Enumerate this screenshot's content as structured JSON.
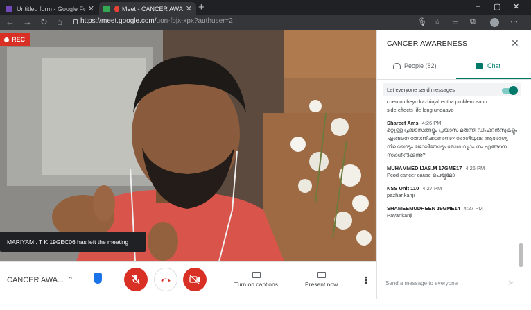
{
  "browser": {
    "tabs": [
      {
        "title": "Untitled form - Google Forms",
        "fav_color": "#7248b9"
      },
      {
        "title": "Meet - CANCER AWARENESS",
        "fav_color": "#34a853"
      }
    ],
    "url_host": "https://meet.google.com/",
    "url_path": "uon-fpjx-xpx?authuser=2"
  },
  "meeting": {
    "rec_label": "REC",
    "toast": "MARIYAM . T K 19GEC06 has left the meeting",
    "name_short": "CANCER AWA...",
    "captions_label": "Turn on captions",
    "present_label": "Present now"
  },
  "panel": {
    "title": "CANCER AWARENESS",
    "people_tab": "People (82)",
    "chat_tab": "Chat",
    "toggle_label": "Let everyone send messages",
    "messages": [
      {
        "sender": "",
        "time": "",
        "text": "chemo cheyo kazhinjal entha problem aanu"
      },
      {
        "sender": "",
        "time": "",
        "text": "side effects life long undaavo"
      },
      {
        "sender": "Shareef Ams",
        "time": "4:26 PM",
        "text": "മറ്റുള്ള പ്രയാസങ്ങളും പ്രയാസ മരുന്നി ഡിഫറൻസുകളും എങ്ങനെ തോന്നിക്കാണുന്നു? രോഗിയുടെ ആരോഗ്യ നിലയോടും ജോലിയോടും രോഗ വ്യാപനം എങ്ങനെ സ്വാധീനിക്കുന്നു?"
      },
      {
        "sender": "MUHAMMED IJAS.M 17GME17",
        "time": "4:26 PM",
        "text": "Pcod cancer cause ചെയ്യുമോ"
      },
      {
        "sender": "NSS Unit 110",
        "time": "4:27 PM",
        "text": "pazhankanji"
      },
      {
        "sender": "SHAMEEMUDHEEN 19GME14",
        "time": "4:27 PM",
        "text": "Payankanji"
      }
    ],
    "compose_placeholder": "Send a message to everyone"
  },
  "colors": {
    "accent": "#00796b",
    "rec": "#d93025",
    "end_call": "#d93025"
  }
}
